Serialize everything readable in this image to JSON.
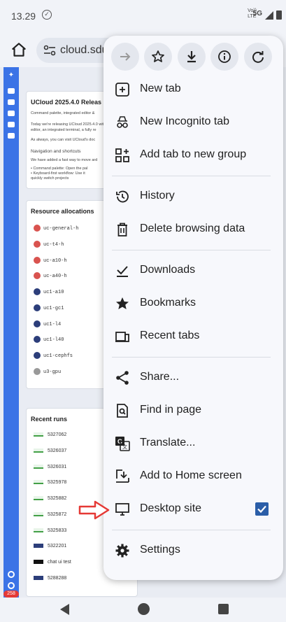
{
  "status_bar": {
    "time": "13.29",
    "network_top": "Vo)) ",
    "network_bottom": "LTE",
    "network_type": "5G"
  },
  "browser": {
    "url": "cloud.sdu",
    "icons": [
      "home-icon",
      "page-info-icon"
    ]
  },
  "menu": {
    "top_actions": [
      {
        "name": "forward",
        "icon": "forward-arrow-icon"
      },
      {
        "name": "bookmark",
        "icon": "star-outline-icon"
      },
      {
        "name": "download",
        "icon": "download-icon"
      },
      {
        "name": "info",
        "icon": "info-icon"
      },
      {
        "name": "reload",
        "icon": "reload-icon"
      }
    ],
    "items": {
      "new_tab": "New tab",
      "new_incognito_tab": "New Incognito tab",
      "add_tab_to_group": "Add tab to new group",
      "history": "History",
      "delete_browsing_data": "Delete browsing data",
      "downloads": "Downloads",
      "bookmarks": "Bookmarks",
      "recent_tabs": "Recent tabs",
      "share": "Share...",
      "find_in_page": "Find in page",
      "translate": "Translate...",
      "add_to_home_screen": "Add to Home screen",
      "desktop_site": "Desktop site",
      "settings": "Settings"
    },
    "desktop_site_checked": true
  },
  "page": {
    "news_card": {
      "title": "UCloud 2025.4.0 Releas",
      "lines": [
        "Command palette, integrated editor &",
        "Today we're releasing UCloud 2025.4.0 with",
        "editor, an integrated terminal, a fully re",
        "As always, you can visit UCloud's doc",
        "Navigation and shortcuts",
        "We have added a fast way to move ard",
        "• Command palette: Open the pal",
        "• Keyboard-first workflow: Use it",
        "quickly switch projects"
      ]
    },
    "allocations_card": {
      "title": "Resource allocations",
      "items": [
        "uc-general-h",
        "uc-t4-h",
        "uc-a10-h",
        "uc-a40-h",
        "uc1-a10",
        "uc1-gc1",
        "uc1-l4",
        "uc1-l40",
        "uc1-cephfs",
        "u3-gpu"
      ]
    },
    "runs_card": {
      "title": "Recent runs",
      "items": [
        "5327062",
        "5326037",
        "5326031",
        "5325978",
        "5325882",
        "5325872",
        "5325833",
        "5322201",
        "chat ui test",
        "5288288"
      ]
    },
    "sidebar_badge": "258"
  },
  "colors": {
    "accent": "#2b5ea8",
    "sidebar": "#3b73e6",
    "pointer": "#e53935"
  }
}
